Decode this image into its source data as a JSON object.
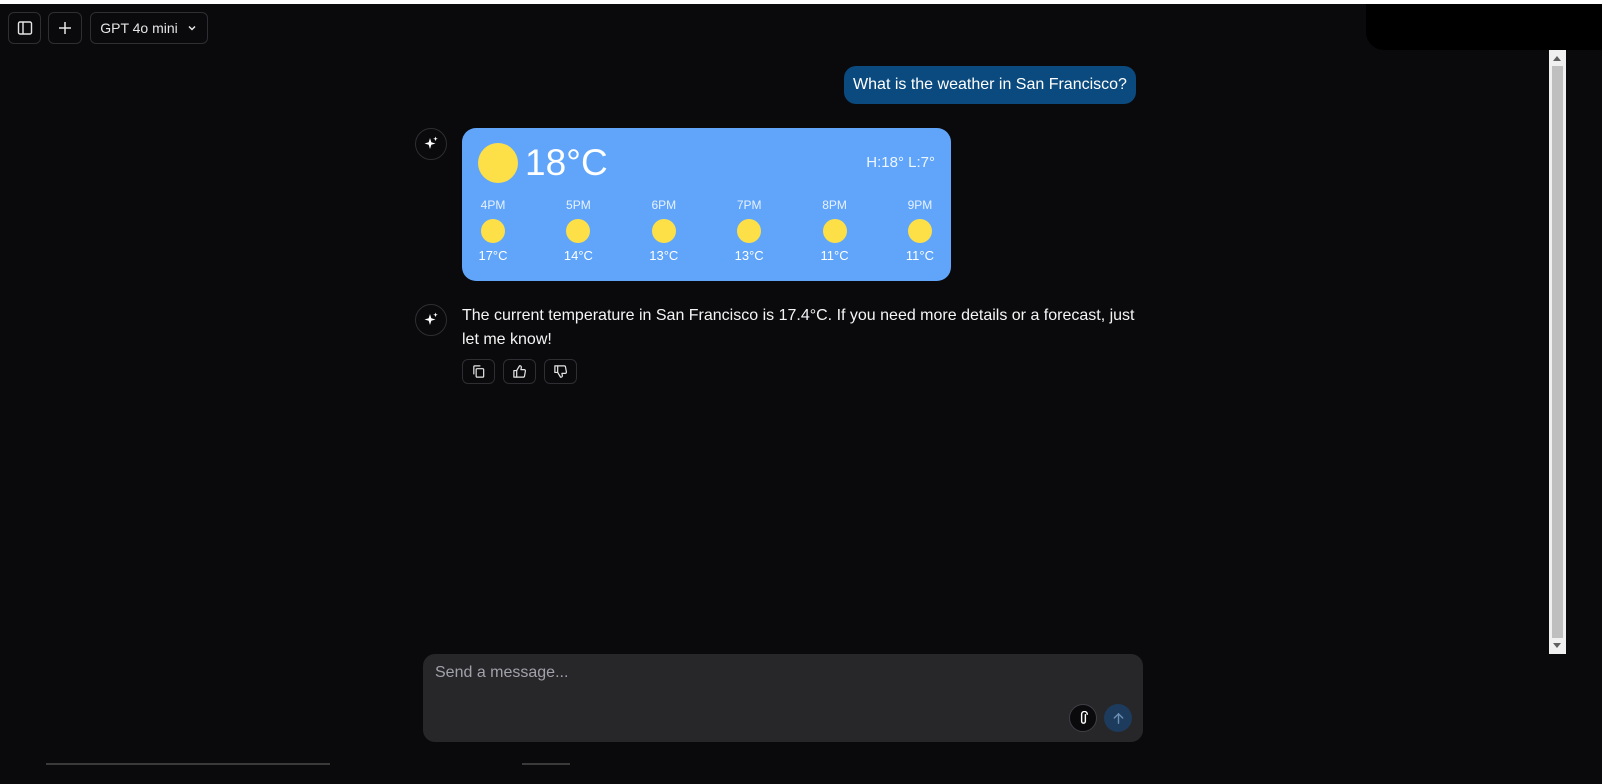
{
  "header": {
    "model_label": "GPT 4o mini"
  },
  "conversation": {
    "user_message": "What is the weather in San Francisco?",
    "weather": {
      "current_temp": "18°C",
      "high_low": "H:18° L:7°",
      "hourly": [
        {
          "time": "4PM",
          "temp": "17°C"
        },
        {
          "time": "5PM",
          "temp": "14°C"
        },
        {
          "time": "6PM",
          "temp": "13°C"
        },
        {
          "time": "7PM",
          "temp": "13°C"
        },
        {
          "time": "8PM",
          "temp": "11°C"
        },
        {
          "time": "9PM",
          "temp": "11°C"
        }
      ]
    },
    "assistant_message": "The current temperature in San Francisco is 17.4°C. If you need more details or a forecast, just let me know!"
  },
  "composer": {
    "placeholder": "Send a message..."
  },
  "colors": {
    "background": "#0a0a0c",
    "user_bubble": "#0b4a7e",
    "weather_card": "#60a5fa",
    "sun": "#fde047",
    "composer": "#27272a"
  },
  "icons": {
    "sidebar_toggle": "sidebar-toggle-icon",
    "new_chat": "plus-icon",
    "model_dropdown": "chevron-down-icon",
    "assistant_avatar": "sparkles-icon",
    "copy": "copy-icon",
    "upvote": "thumbs-up-icon",
    "downvote": "thumbs-down-icon",
    "attach": "paperclip-icon",
    "send": "arrow-up-icon"
  }
}
